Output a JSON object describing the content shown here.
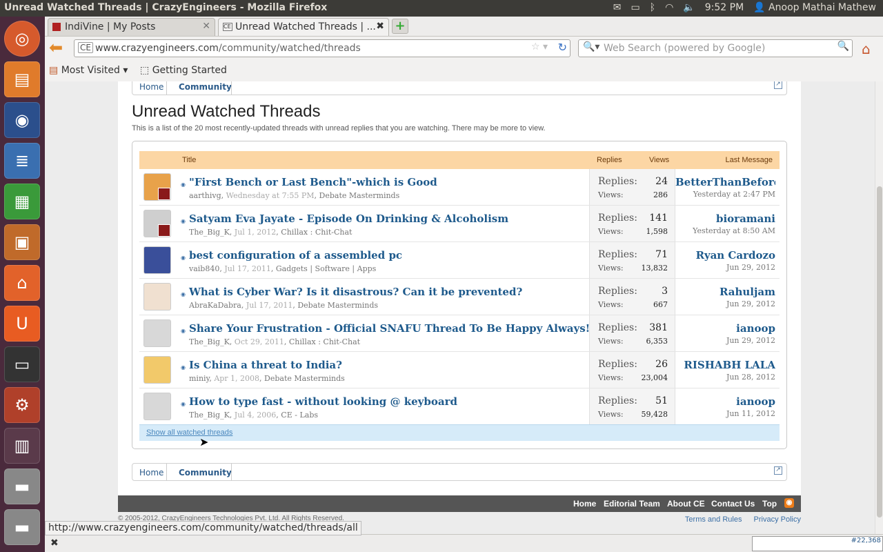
{
  "os": {
    "window_title": "Unread Watched Threads | CrazyEngineers - Mozilla Firefox",
    "clock": "9:52 PM",
    "user": "Anoop Mathai Mathew"
  },
  "browser": {
    "tabs": [
      {
        "label": "IndiVine | My Posts"
      },
      {
        "label": "Unread Watched Threads | ..."
      }
    ],
    "url_host": "www.crazyengineers.com",
    "url_path": "/community/watched/threads",
    "url_badge": "CE",
    "search_placeholder": "Web Search (powered by Google)",
    "bookmarks": [
      "Most Visited",
      "Getting Started"
    ],
    "status_url": "http://www.crazyengineers.com/community/watched/threads/all",
    "counter": "#22,368"
  },
  "page": {
    "breadcrumb": [
      "Home",
      "Community"
    ],
    "title": "Unread Watched Threads",
    "description": "This is a list of the 20 most recently-updated threads with unread replies that you are watching. There may be more to view.",
    "columns": {
      "title": "Title",
      "replies": "Replies",
      "views": "Views",
      "last": "Last Message"
    },
    "replies_label": "Replies:",
    "views_label": "Views:",
    "threads": [
      {
        "title": "\"First Bench or Last Bench\"-which is Good",
        "author": "aarthivg",
        "date": "Wednesday at 7:55 PM",
        "forum": "Debate Masterminds",
        "replies": "24",
        "views": "286",
        "last_user": "BetterThanBefore",
        "last_date": "Yesterday at 2:47 PM"
      },
      {
        "title": "Satyam Eva Jayate - Episode On Drinking & Alcoholism",
        "author": "The_Big_K",
        "date": "Jul 1, 2012",
        "forum": "Chillax : Chit-Chat",
        "replies": "141",
        "views": "1,598",
        "last_user": "bioramani",
        "last_date": "Yesterday at 8:50 AM"
      },
      {
        "title": "best configuration of a assembled pc",
        "author": "vaib840",
        "date": "Jul 17, 2011",
        "forum": "Gadgets | Software | Apps",
        "replies": "71",
        "views": "13,832",
        "last_user": "Ryan Cardozo",
        "last_date": "Jun 29, 2012"
      },
      {
        "title": "What is Cyber War? Is it disastrous? Can it be prevented?",
        "author": "AbraKaDabra",
        "date": "Jul 17, 2011",
        "forum": "Debate Masterminds",
        "replies": "3",
        "views": "667",
        "last_user": "Rahuljam",
        "last_date": "Jun 29, 2012"
      },
      {
        "title": "Share Your Frustration - Official SNAFU Thread To Be Happy Always!",
        "author": "The_Big_K",
        "date": "Oct 29, 2011",
        "forum": "Chillax : Chit-Chat",
        "replies": "381",
        "views": "6,353",
        "last_user": "ianoop",
        "last_date": "Jun 29, 2012"
      },
      {
        "title": "Is China a threat to India?",
        "author": "miniy",
        "date": "Apr 1, 2008",
        "forum": "Debate Masterminds",
        "replies": "26",
        "views": "23,004",
        "last_user": "RISHABH LALA",
        "last_date": "Jun 28, 2012"
      },
      {
        "title": "How to type fast - without looking @ keyboard",
        "author": "The_Big_K",
        "date": "Jul 4, 2006",
        "forum": "CE - Labs",
        "replies": "51",
        "views": "59,428",
        "last_user": "ianoop",
        "last_date": "Jun 11, 2012"
      }
    ],
    "show_all": "Show all watched threads",
    "footer_links": [
      "Home",
      "Editorial Team",
      "About CE",
      "Contact Us",
      "Top"
    ],
    "copyright": "© 2005-2012, CrazyEngineers Technologies Pvt. Ltd. All Rights Reserved.",
    "legal": [
      "Terms and Rules",
      "Privacy Policy"
    ]
  }
}
